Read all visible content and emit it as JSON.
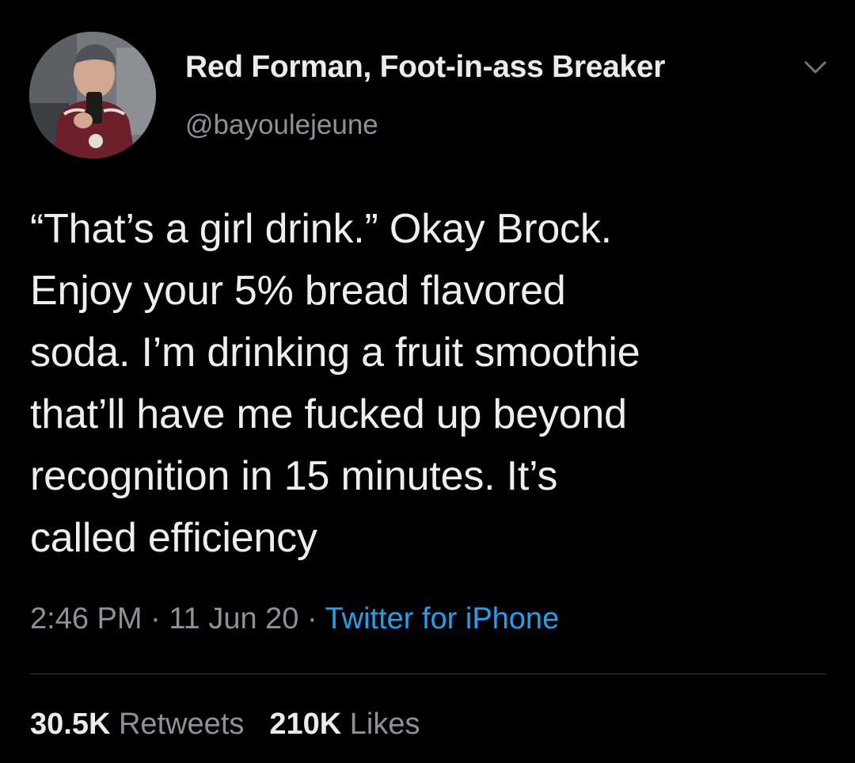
{
  "author": {
    "display_name": "Red Forman, Foot-in-ass Breaker",
    "handle": "@bayoulejeune",
    "avatar_icon": "profile-photo",
    "menu_icon": "chevron-down-icon"
  },
  "tweet": {
    "lines": [
      "“That’s a girl drink.” Okay Brock.",
      "Enjoy your 5% bread flavored",
      "soda. I’m drinking a fruit smoothie",
      "that’ll have me fucked up beyond",
      "recognition in 15 minutes. It’s",
      "called efficiency"
    ]
  },
  "meta": {
    "time": "2:46 PM",
    "separator": " · ",
    "date": "11 Jun 20",
    "source": "Twitter for iPhone"
  },
  "stats": {
    "retweets_count": "30.5K",
    "retweets_label": "Retweets",
    "likes_count": "210K",
    "likes_label": "Likes"
  },
  "colors": {
    "background": "#000000",
    "primary_text": "#eceef0",
    "secondary_text": "#8b9298",
    "link": "#1da1f2",
    "divider": "#2f3336"
  }
}
